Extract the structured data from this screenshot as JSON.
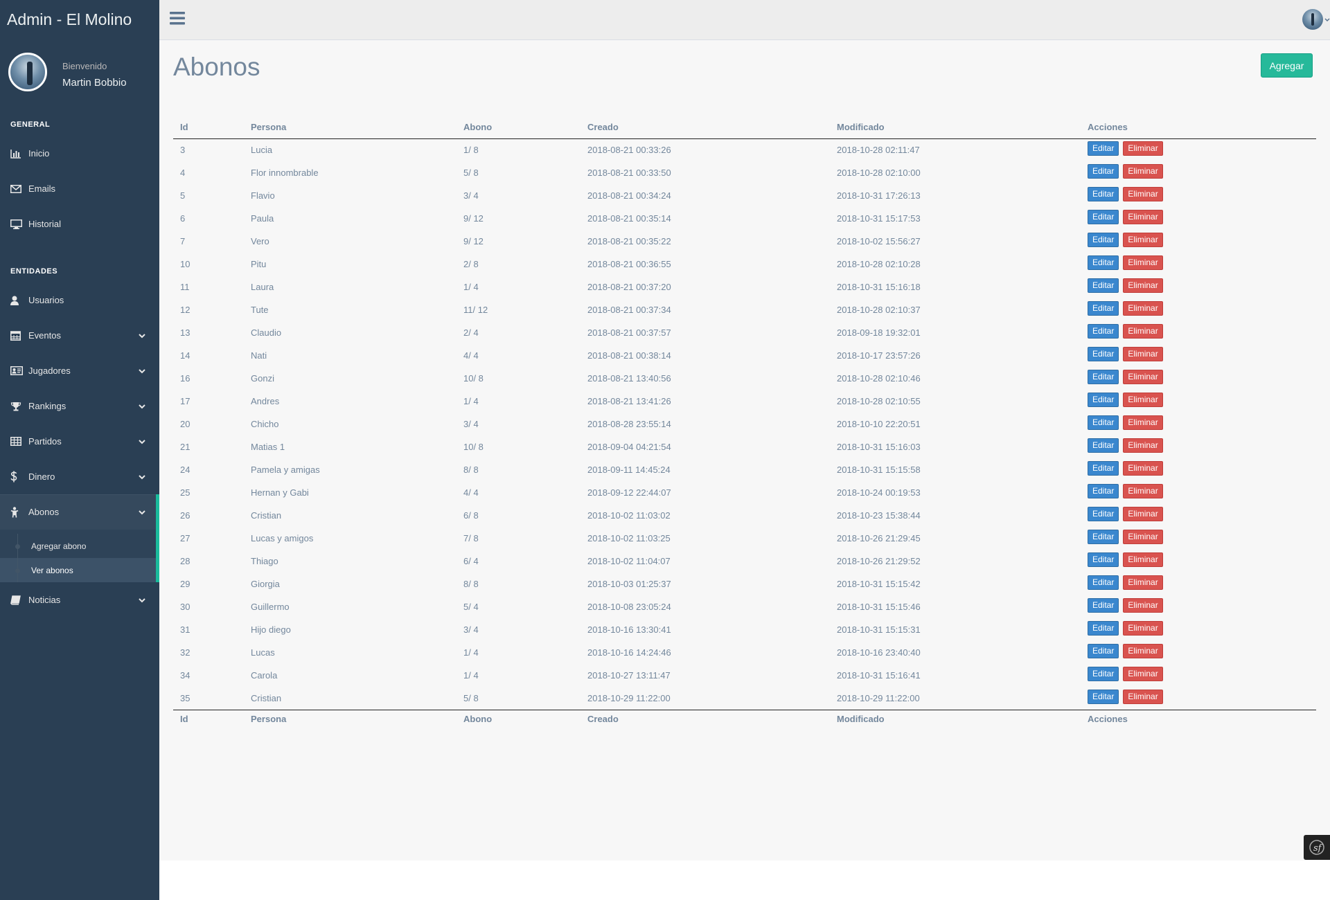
{
  "app": {
    "title": "Admin - El Molino"
  },
  "profile": {
    "welcome": "Bienvenido",
    "name": "Martin Bobbio"
  },
  "sidebar": {
    "general_title": "GENERAL",
    "general": [
      {
        "label": "Inicio",
        "icon": "bar-chart-icon"
      },
      {
        "label": "Emails",
        "icon": "envelope-icon"
      },
      {
        "label": "Historial",
        "icon": "desktop-icon"
      }
    ],
    "entities_title": "ENTIDADES",
    "entities": [
      {
        "label": "Usuarios",
        "icon": "user-icon"
      },
      {
        "label": "Eventos",
        "icon": "calendar-icon"
      },
      {
        "label": "Jugadores",
        "icon": "id-card-icon"
      },
      {
        "label": "Rankings",
        "icon": "trophy-icon"
      },
      {
        "label": "Partidos",
        "icon": "table-icon"
      },
      {
        "label": "Dinero",
        "icon": "dollar-icon"
      },
      {
        "label": "Abonos",
        "icon": "child-icon"
      },
      {
        "label": "Noticias",
        "icon": "book-icon"
      }
    ],
    "abonos_sub": [
      "Agregar abono",
      "Ver abonos"
    ]
  },
  "page": {
    "title": "Abonos",
    "add_label": "Agregar"
  },
  "table": {
    "columns": [
      "Id",
      "Persona",
      "Abono",
      "Creado",
      "Modificado",
      "Acciones"
    ],
    "edit_label": "Editar",
    "delete_label": "Eliminar",
    "rows": [
      [
        "3",
        "Lucia",
        "1/ 8",
        "2018-08-21 00:33:26",
        "2018-10-28 02:11:47"
      ],
      [
        "4",
        "Flor innombrable",
        "5/ 8",
        "2018-08-21 00:33:50",
        "2018-10-28 02:10:00"
      ],
      [
        "5",
        "Flavio",
        "3/ 4",
        "2018-08-21 00:34:24",
        "2018-10-31 17:26:13"
      ],
      [
        "6",
        "Paula",
        "9/ 12",
        "2018-08-21 00:35:14",
        "2018-10-31 15:17:53"
      ],
      [
        "7",
        "Vero",
        "9/ 12",
        "2018-08-21 00:35:22",
        "2018-10-02 15:56:27"
      ],
      [
        "10",
        "Pitu",
        "2/ 8",
        "2018-08-21 00:36:55",
        "2018-10-28 02:10:28"
      ],
      [
        "11",
        "Laura",
        "1/ 4",
        "2018-08-21 00:37:20",
        "2018-10-31 15:16:18"
      ],
      [
        "12",
        "Tute",
        "11/ 12",
        "2018-08-21 00:37:34",
        "2018-10-28 02:10:37"
      ],
      [
        "13",
        "Claudio",
        "2/ 4",
        "2018-08-21 00:37:57",
        "2018-09-18 19:32:01"
      ],
      [
        "14",
        "Nati",
        "4/ 4",
        "2018-08-21 00:38:14",
        "2018-10-17 23:57:26"
      ],
      [
        "16",
        "Gonzi",
        "10/ 8",
        "2018-08-21 13:40:56",
        "2018-10-28 02:10:46"
      ],
      [
        "17",
        "Andres",
        "1/ 4",
        "2018-08-21 13:41:26",
        "2018-10-28 02:10:55"
      ],
      [
        "20",
        "Chicho",
        "3/ 4",
        "2018-08-28 23:55:14",
        "2018-10-10 22:20:51"
      ],
      [
        "21",
        "Matias 1",
        "10/ 8",
        "2018-09-04 04:21:54",
        "2018-10-31 15:16:03"
      ],
      [
        "24",
        "Pamela y amigas",
        "8/ 8",
        "2018-09-11 14:45:24",
        "2018-10-31 15:15:58"
      ],
      [
        "25",
        "Hernan y Gabi",
        "4/ 4",
        "2018-09-12 22:44:07",
        "2018-10-24 00:19:53"
      ],
      [
        "26",
        "Cristian",
        "6/ 8",
        "2018-10-02 11:03:02",
        "2018-10-23 15:38:44"
      ],
      [
        "27",
        "Lucas y amigos",
        "7/ 8",
        "2018-10-02 11:03:25",
        "2018-10-26 21:29:45"
      ],
      [
        "28",
        "Thiago",
        "6/ 4",
        "2018-10-02 11:04:07",
        "2018-10-26 21:29:52"
      ],
      [
        "29",
        "Giorgia",
        "8/ 8",
        "2018-10-03 01:25:37",
        "2018-10-31 15:15:42"
      ],
      [
        "30",
        "Guillermo",
        "5/ 4",
        "2018-10-08 23:05:24",
        "2018-10-31 15:15:46"
      ],
      [
        "31",
        "Hijo diego",
        "3/ 4",
        "2018-10-16 13:30:41",
        "2018-10-31 15:15:31"
      ],
      [
        "32",
        "Lucas",
        "1/ 4",
        "2018-10-16 14:24:46",
        "2018-10-16 23:40:40"
      ],
      [
        "34",
        "Carola",
        "1/ 4",
        "2018-10-27 13:11:47",
        "2018-10-31 15:16:41"
      ],
      [
        "35",
        "Cristian",
        "5/ 8",
        "2018-10-29 11:22:00",
        "2018-10-29 11:22:00"
      ]
    ]
  },
  "colors": {
    "sidebar_bg": "#2A3F54",
    "accent": "#1ABB9C",
    "add_button": "#26B99A",
    "edit_button": "#3A87CE",
    "delete_button": "#D9534F",
    "text": "#73879C"
  }
}
